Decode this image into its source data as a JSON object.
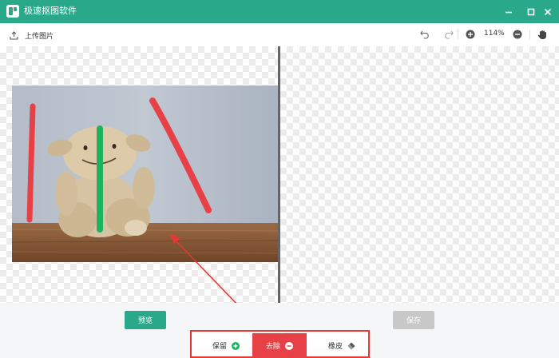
{
  "app": {
    "title": "极速抠图软件",
    "icon": "app-logo-icon",
    "window_controls": [
      "minimize-icon",
      "maximize-icon",
      "close-icon"
    ]
  },
  "toolbar": {
    "upload_label": "上传图片",
    "upload_icon": "upload-icon",
    "undo_icon": "undo-icon",
    "redo_icon": "redo-icon",
    "zoom_in_icon": "zoom-in-icon",
    "zoom_level": "114%",
    "zoom_out_icon": "zoom-out-icon",
    "pan_icon": "hand-icon"
  },
  "actions": {
    "preview_label": "预览",
    "save_label": "保存"
  },
  "modes": {
    "keep_label": "保留",
    "remove_label": "去除",
    "eraser_label": "橡皮",
    "selected": "去除"
  },
  "colors": {
    "brand": "#29a98a",
    "remove_red": "#e84047",
    "highlight_border": "#e53935",
    "keep_stroke": "#1bb35e",
    "remove_stroke": "#e84047",
    "save_disabled": "#c8c8c8"
  }
}
